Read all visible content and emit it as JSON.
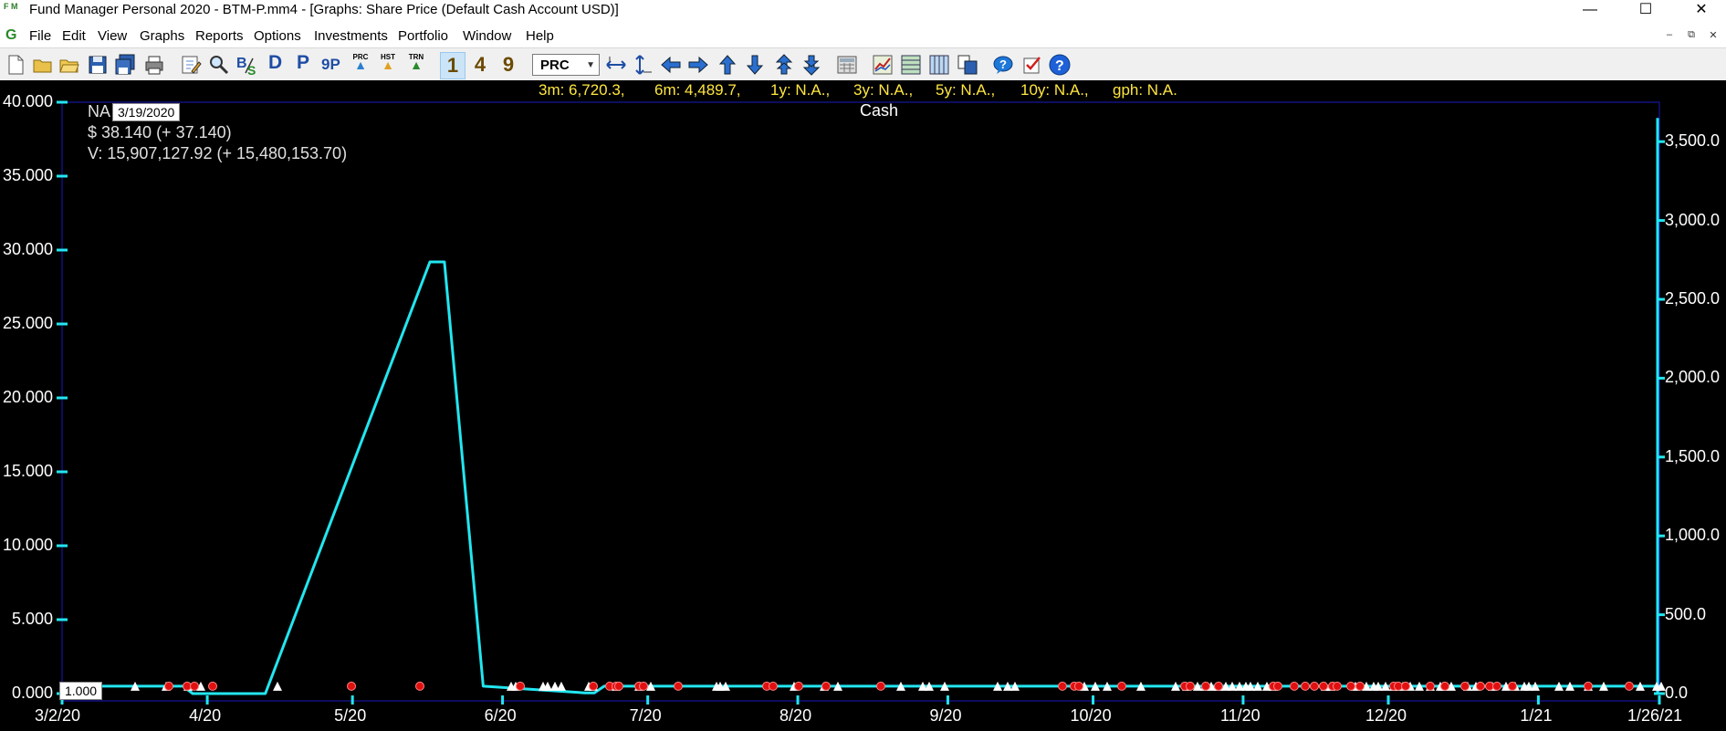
{
  "window": {
    "title": "Fund Manager Personal 2020 - BTM-P.mm4 - [Graphs: Share Price (Default Cash Account USD)]",
    "app_icon_text": "F M"
  },
  "menu": {
    "logo": "G",
    "items": [
      "File",
      "Edit",
      "View",
      "Graphs",
      "Reports",
      "Options",
      "Investments",
      "Portfolio",
      "Window",
      "Help"
    ]
  },
  "toolbar": {
    "letters": [
      "D",
      "P",
      "9P"
    ],
    "small_labels": [
      "PRC",
      "HST",
      "TRN"
    ],
    "numbers": [
      "1",
      "4",
      "9"
    ],
    "combo_value": "PRC"
  },
  "stats": [
    "3m: 6,720.3,",
    "6m: 4,489.7,",
    "1y: N.A.,",
    "3y: N.A.,",
    "5y: N.A.,",
    "10y: N.A.,",
    "gph: N.A."
  ],
  "graph": {
    "series_label": "Cash",
    "info": {
      "name_prefix": "NA",
      "date_tip": "3/19/2020",
      "price_line": "$ 38.140 (+ 37.140)",
      "value_line": "V: 15,907,127.92 (+ 15,480,153.70)",
      "value_tip": "1.000"
    },
    "colors": {
      "line": "#22e6f0",
      "stats": "#ffe640",
      "buy_marker": "#ffffff",
      "sell_marker": "#e01010"
    }
  },
  "chart_data": {
    "type": "line",
    "x": [
      "3/2/20",
      "3/15/20",
      "3/27/20",
      "3/29/20",
      "4/13/20",
      "5/17/20",
      "5/20/20",
      "5/28/20",
      "6/18/20",
      "6/20/20",
      "6/22/20",
      "1/24/21",
      "1/25/21",
      "1/26/21"
    ],
    "series": [
      {
        "values": [
          0.5,
          0.5,
          0.5,
          0,
          0,
          29.2,
          29.2,
          0.5,
          0.05,
          0.05,
          0.5,
          0.5,
          0.5,
          0.5
        ]
      }
    ],
    "right_axis_series": {
      "values_at_end": [
        0,
        3650
      ]
    },
    "ylim_left": [
      0,
      40
    ],
    "yticks_left": [
      "0.000",
      "5.000",
      "10.000",
      "15.000",
      "20.000",
      "25.000",
      "30.000",
      "35.000",
      "40.000"
    ],
    "ylim_right": [
      0,
      3750
    ],
    "yticks_right": [
      "0.0",
      "500.0",
      "1,000.0",
      "1,500.0",
      "2,000.0",
      "2,500.0",
      "3,000.0",
      "3,500.0"
    ],
    "xticks": [
      "3/2/20",
      "4/20",
      "5/20",
      "6/20",
      "7/20",
      "8/20",
      "9/20",
      "10/20",
      "11/20",
      "12/20",
      "1/21",
      "1/26/21"
    ],
    "grid": false
  }
}
